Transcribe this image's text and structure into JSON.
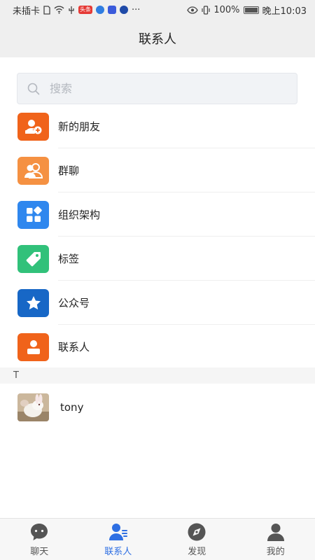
{
  "status_bar": {
    "carrier": "未插卡",
    "battery_percent": "100%",
    "time": "晚上10:03",
    "chip_text": "头条",
    "more": "···"
  },
  "header": {
    "title": "联系人"
  },
  "search": {
    "placeholder": "搜索"
  },
  "menu": [
    {
      "label": "新的朋友",
      "icon": "add-user-icon",
      "color": "#f0631a"
    },
    {
      "label": "群聊",
      "icon": "group-icon",
      "color": "#f59142"
    },
    {
      "label": "组织架构",
      "icon": "apps-icon",
      "color": "#2f87ee"
    },
    {
      "label": "标签",
      "icon": "tag-icon",
      "color": "#31c17a"
    },
    {
      "label": "公众号",
      "icon": "star-icon",
      "color": "#1767c6"
    },
    {
      "label": "联系人",
      "icon": "person-icon",
      "color": "#f0631a"
    }
  ],
  "section": {
    "letter": "T"
  },
  "contacts": [
    {
      "name": "tony"
    }
  ],
  "tabs": [
    {
      "label": "聊天",
      "icon": "chat-icon",
      "active": false
    },
    {
      "label": "联系人",
      "icon": "contacts-icon",
      "active": true
    },
    {
      "label": "发现",
      "icon": "compass-icon",
      "active": false
    },
    {
      "label": "我的",
      "icon": "profile-icon",
      "active": false
    }
  ],
  "colors": {
    "accent": "#2e6fe3",
    "inactive_tab": "#555555",
    "header_bg": "#efefef"
  }
}
